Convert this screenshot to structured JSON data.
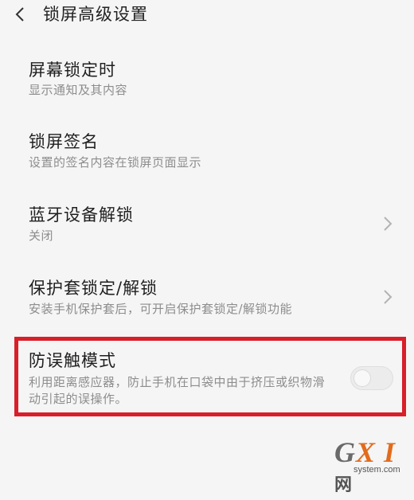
{
  "header": {
    "title": "锁屏高级设置",
    "back_icon": "chevron-left-icon"
  },
  "settings": [
    {
      "title": "屏幕锁定时",
      "desc": "显示通知及其内容",
      "has_chevron": false
    },
    {
      "title": "锁屏签名",
      "desc": "设置的签名内容在锁屏页面显示",
      "has_chevron": false
    },
    {
      "title": "蓝牙设备解锁",
      "desc": "关闭",
      "has_chevron": true
    },
    {
      "title": "保护套锁定/解锁",
      "desc": "安装手机保护套后，可开启保护套锁定/解锁功能",
      "has_chevron": true
    },
    {
      "title": "防误触模式",
      "desc": "利用距离感应器，防止手机在口袋中由于挤压或织物滑动引起的误操作。",
      "toggle_on": false
    }
  ],
  "watermark": {
    "logo_g": "G",
    "logo_xi": "X I",
    "logo_net": "网",
    "domain": "system.com"
  },
  "colors": {
    "background": "#f5f5f5",
    "highlight_border": "#d81f2a",
    "desc_text": "#8d8d8d"
  }
}
